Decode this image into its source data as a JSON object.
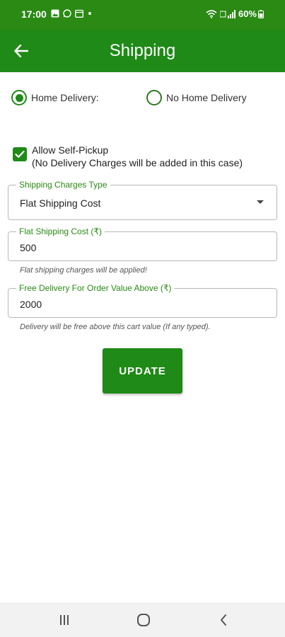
{
  "status_bar": {
    "time": "17:00",
    "battery": "60%"
  },
  "app_bar": {
    "title": "Shipping"
  },
  "delivery_options": {
    "home_delivery_label": "Home Delivery:",
    "no_home_delivery_label": "No Home Delivery",
    "selected": "home_delivery"
  },
  "self_pickup": {
    "checked": true,
    "label": "Allow Self-Pickup",
    "note": "(No Delivery Charges will be added in this case)"
  },
  "shipping_charges_type": {
    "label": "Shipping Charges Type",
    "value": "Flat Shipping Cost"
  },
  "flat_shipping_cost": {
    "label": "Flat Shipping Cost (₹)",
    "value": "500",
    "helper": "Flat shipping charges will be applied!"
  },
  "free_delivery": {
    "label": "Free Delivery For Order Value Above (₹)",
    "value": "2000",
    "helper": "Delivery will be free above this cart value (If any typed)."
  },
  "update_button": {
    "label": "UPDATE"
  },
  "colors": {
    "primary": "#1f8a17",
    "status_bar": "#2a8a14"
  }
}
